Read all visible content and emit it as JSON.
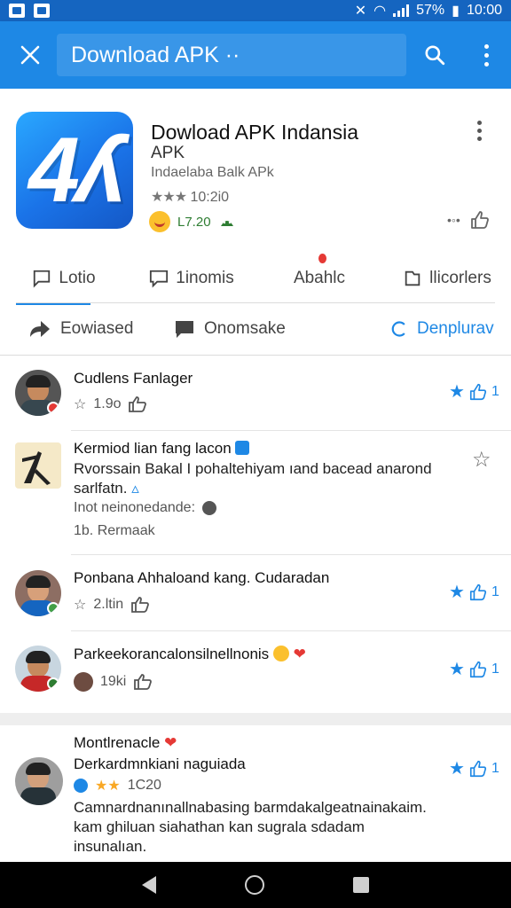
{
  "status_bar": {
    "battery_percent": "57%",
    "time": "10:00"
  },
  "app_bar": {
    "search_text": "Download APK ··",
    "close_icon": "close-icon",
    "search_icon": "search-icon",
    "more_icon": "more-vert-icon"
  },
  "app": {
    "title": "Dowload APK Indansia",
    "subtitle": "APK",
    "developer": "Indaelaba Balk APk",
    "rating_stars": "★★★",
    "rating_text": "10:2i0",
    "badge_text": "L7.20"
  },
  "tabs": [
    {
      "label": "Lotio",
      "icon": "comment-outline-icon"
    },
    {
      "label": "1inomis",
      "icon": "chat-bubble-outline-icon"
    },
    {
      "label": "Abahlc",
      "icon": ""
    },
    {
      "label": "llicorlers",
      "icon": "folder-outline-icon"
    }
  ],
  "actions": {
    "download": "Eowiased",
    "comments": "Onomsake",
    "refresh": "Denplurav"
  },
  "comments": [
    {
      "name": "Cudlens Fanlager",
      "meta": "1.9o",
      "likes": "1"
    },
    {
      "name": "Kermiod lian fang lacon",
      "body_line1": "Rvorssain Bakal I pohaltehiyam ıand bacead anarond",
      "body_line2": "sarlfatn.",
      "meta": "Inot neinonedande:",
      "replies": "1b. Rermaak"
    },
    {
      "name": "Ponbana Ahhaloand kang. Cudaradan",
      "meta": "2.ltin",
      "likes": "1"
    },
    {
      "name": "Parkeekorancalonsilnellnonis",
      "meta": "19ki",
      "likes": "1"
    }
  ],
  "featured_comment": {
    "name": "Montlrenacle",
    "subtitle": "Derkardmnkiani naguiada",
    "rating_stars": "★★",
    "rating_text": "1C20",
    "body_line1": "Camnardnanınallnabasing barmdakalgeatnainakaim.",
    "body_line2": "kam ghiluan siahathan kan sugrala sdadam",
    "body_line3": "insunalıan.",
    "likes": "1"
  },
  "colors": {
    "primary": "#1e88e5",
    "status": "#1565c0"
  }
}
